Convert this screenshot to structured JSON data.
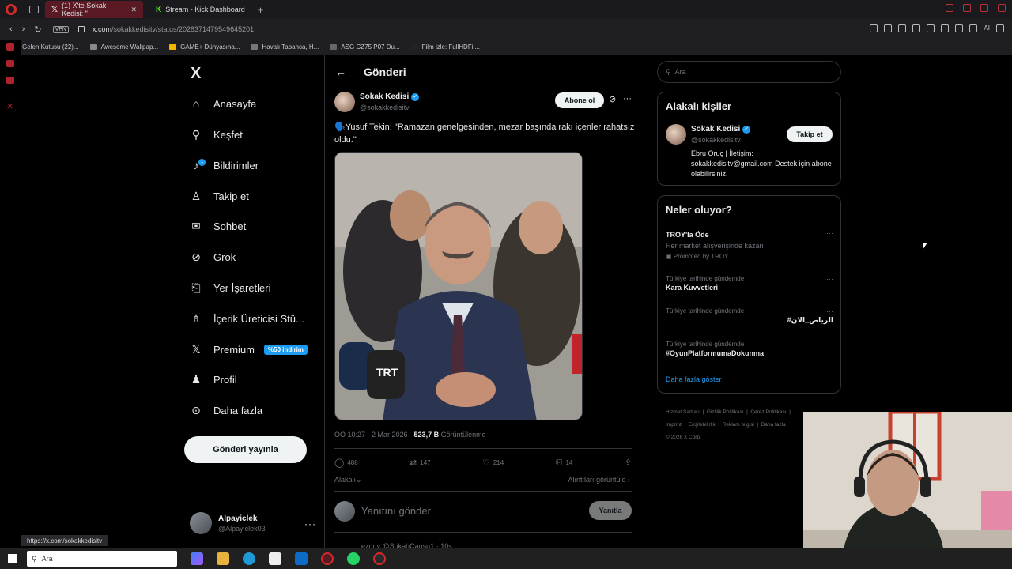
{
  "browser": {
    "tabs": [
      {
        "label": "(1) X'te Sokak Kedisi: \"",
        "icon": "x-icon",
        "active": true
      },
      {
        "label": "Stream - Kick Dashboard",
        "icon": "kick-icon",
        "active": false
      }
    ],
    "new_tab": "+",
    "url_host": "x.com",
    "url_path": "/sokakkedisitv/status/2028371479549645201",
    "vpn_label": "VPN",
    "ai_label": "AI",
    "bookmarks": [
      "Gelen Kutusu (22)...",
      "Awesome Wallpap...",
      "GAME+ Dünyasına...",
      "Havalı Tabanca, H...",
      "ASG CZ75 P07 Du...",
      "Film izle: FullHDFil..."
    ],
    "status_url": "https://x.com/sokakkedisitv",
    "accent_color": "#d62a2a"
  },
  "sidebar": {
    "logo": "X",
    "items": [
      {
        "label": "Anasayfa",
        "icon": "home-icon"
      },
      {
        "label": "Keşfet",
        "icon": "search-icon"
      },
      {
        "label": "Bildirimler",
        "icon": "bell-icon",
        "badge": "1"
      },
      {
        "label": "Takip et",
        "icon": "add-person-icon"
      },
      {
        "label": "Sohbet",
        "icon": "mail-icon"
      },
      {
        "label": "Grok",
        "icon": "grok-icon"
      },
      {
        "label": "Yer İşaretleri",
        "icon": "bookmark-icon"
      },
      {
        "label": "İçerik Üreticisi Stü...",
        "icon": "creator-icon"
      },
      {
        "label": "Premium",
        "icon": "x-premium-icon",
        "promo": "%50 indirim"
      },
      {
        "label": "Profil",
        "icon": "person-icon"
      },
      {
        "label": "Daha fazla",
        "icon": "more-circle-icon"
      }
    ],
    "post_button": "Gönderi yayınla",
    "account": {
      "name": "Alpayiclek",
      "handle": "@Alpayiclek03",
      "more": "···"
    }
  },
  "post": {
    "header_title": "Gönderi",
    "author_name": "Sokak Kedisi",
    "author_handle": "@sokakkedisitv",
    "subscribe_button": "Abone ol",
    "more": "···",
    "text": "🗣️Yusuf Tekin: \"Ramazan genelgesinden, mezar başında rakı içenler rahatsız oldu.\"",
    "time": "ÖÖ 10:27 · 2 Mar 2026 · ",
    "views_count": "523,7 B",
    "views_label": " Görüntülenme",
    "replies": "488",
    "reposts": "147",
    "likes": "214",
    "bookmarks": "14",
    "relevant_label": "Alakalı",
    "quotes_label": "Alıntıları görüntüle",
    "reply_placeholder": "Yanıtını gönder",
    "reply_button": "Yanıtla",
    "next_reply_preview": "ezgny @SokahCansu1 · 10s"
  },
  "right": {
    "search_placeholder": "Ara",
    "relevant_title": "Alakalı kişiler",
    "relevant_person": {
      "name": "Sokak Kedisi",
      "handle": "@sokakkedisitv",
      "follow_button": "Takip et",
      "bio": "Ebru Oruç | İletişim: sokakkedisitv@gmail.com Destek için abone olabilirsiniz."
    },
    "trends_title": "Neler oluyor?",
    "trends": [
      {
        "context": "",
        "name": "TROY'la Öde",
        "sub": "Her market alışverişinde kazan",
        "promo": "Promoted by TROY"
      },
      {
        "context": "Türkiye tarihinde gündemde",
        "name": "Kara Kuvvetleri",
        "sub": "",
        "promo": ""
      },
      {
        "context": "Türkiye tarihinde gündemde",
        "name": "#الرياض_الان",
        "sub": "",
        "promo": ""
      },
      {
        "context": "Türkiye tarihinde gündemde",
        "name": "#OyunPlatformumaDokunma",
        "sub": "",
        "promo": ""
      }
    ],
    "show_more": "Daha fazla göster",
    "footer_links": [
      "Hizmet Şartları",
      "Gizlilik Politikası",
      "Çerez Politikası",
      "Imprint",
      "Erişilebilirlik",
      "Reklam bilgisi",
      "Daha fazla",
      "© 2026 X Corp."
    ]
  },
  "taskbar": {
    "search_placeholder": "Ara"
  }
}
